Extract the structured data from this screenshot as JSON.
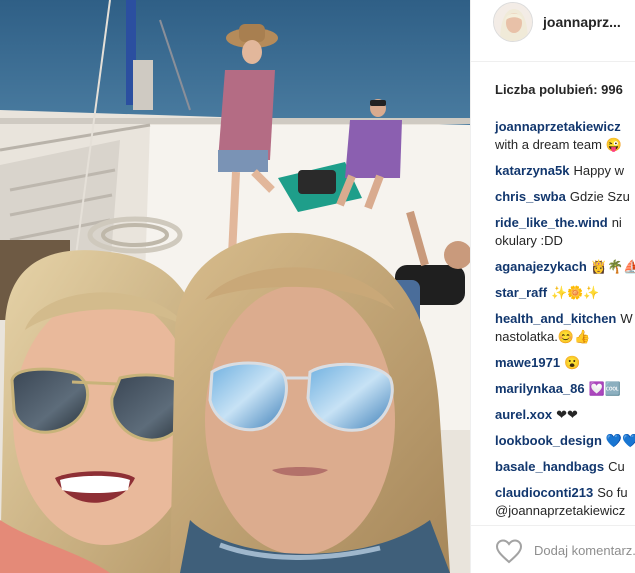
{
  "post": {
    "username": "joannaprz...",
    "likes_label": "Liczba polubień: 996",
    "add_comment_placeholder": "Dodaj komentarz..."
  },
  "icons": {
    "like": "heart-outline-icon",
    "emoji_colors": [
      "#f5c518",
      "#e0245e",
      "#18a999"
    ]
  },
  "comments": [
    {
      "user": "joannaprzetakiewicz",
      "lines": [
        "",
        "with a dream team 😜"
      ]
    },
    {
      "user": "katarzyna5k",
      "text": "Happy w"
    },
    {
      "user": "chris_swba",
      "text": "Gdzie Szu"
    },
    {
      "user": "ride_like_the.wind",
      "lines": [
        "ni",
        "okulary :DD"
      ]
    },
    {
      "user": "aganajezykach",
      "text": "👸🌴⛵"
    },
    {
      "user": "star_raff",
      "text": "✨🌼✨"
    },
    {
      "user": "health_and_kitchen",
      "lines": [
        "W",
        "nastolatka.😊👍"
      ]
    },
    {
      "user": "mawe1971",
      "text": "😮"
    },
    {
      "user": "marilynkaa_86",
      "text": "💟🆒"
    },
    {
      "user": "aurel.xox",
      "text": "❤❤"
    },
    {
      "user": "lookbook_design",
      "text": "💙💙"
    },
    {
      "user": "basale_handbags",
      "text": "Cu"
    },
    {
      "user": "claudioconti213",
      "lines": [
        "So fu",
        "@joannaprzetakiewicz"
      ]
    }
  ]
}
